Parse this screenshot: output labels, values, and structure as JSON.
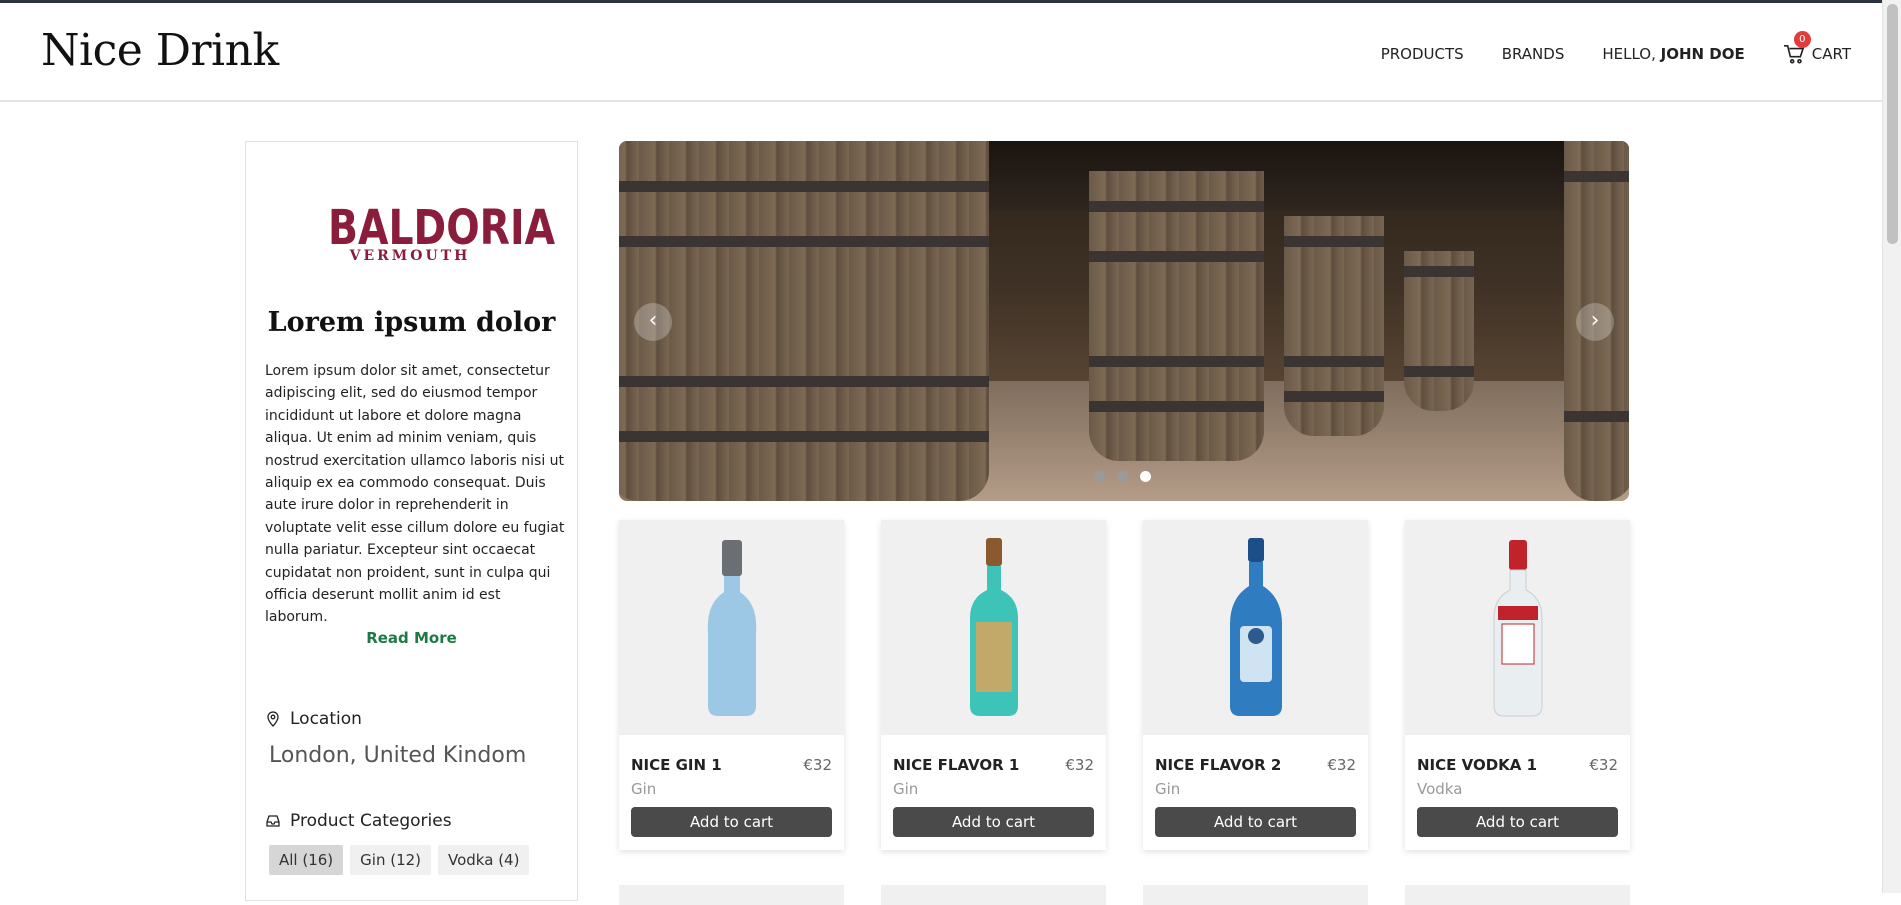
{
  "header": {
    "logo": "Nice Drink",
    "nav": {
      "products": "PRODUCTS",
      "brands": "BRANDS",
      "hello_prefix": "HELLO, ",
      "user_name": "JOHN DOE",
      "cart": "CART",
      "cart_count": "0"
    }
  },
  "brand": {
    "logo_main": "BALDORIA",
    "logo_sub": "VERMOUTH",
    "title": "Lorem ipsum dolor",
    "description": "Lorem ipsum dolor sit amet, consectetur adipiscing elit, sed do eiusmod tempor incididunt ut labore et dolore magna aliqua. Ut enim ad minim veniam, quis nostrud exercitation ullamco laboris nisi ut aliquip ex ea commodo consequat. Duis aute irure dolor in reprehenderit in voluptate velit esse cillum dolore eu fugiat nulla pariatur. Excepteur sint occaecat cupidatat non proident, sunt in culpa qui officia deserunt mollit anim id est laborum.",
    "read_more": "Read More",
    "location_label": "Location",
    "location_value": "London, United Kindom",
    "categories_label": "Product Categories",
    "categories": [
      "All (16)",
      "Gin (12)",
      "Vodka (4)"
    ]
  },
  "carousel": {
    "active_slide": 3,
    "slide_count": 3
  },
  "products": [
    {
      "name": "NICE GIN 1",
      "price": "€32",
      "category": "Gin",
      "button": "Add to cart",
      "bottle_color": "#9cc8e6"
    },
    {
      "name": "NICE FLAVOR 1",
      "price": "€32",
      "category": "Gin",
      "button": "Add to cart",
      "bottle_color": "#3ec3b8"
    },
    {
      "name": "NICE FLAVOR 2",
      "price": "€32",
      "category": "Gin",
      "button": "Add to cart",
      "bottle_color": "#2f7cc0"
    },
    {
      "name": "NICE VODKA 1",
      "price": "€32",
      "category": "Vodka",
      "button": "Add to cart",
      "bottle_color": "#e9eef0"
    }
  ],
  "colors": {
    "brand_accent": "#8a1c3c",
    "read_more": "#1d7a46",
    "badge": "#e23b3b",
    "button": "#4a4a4a"
  }
}
